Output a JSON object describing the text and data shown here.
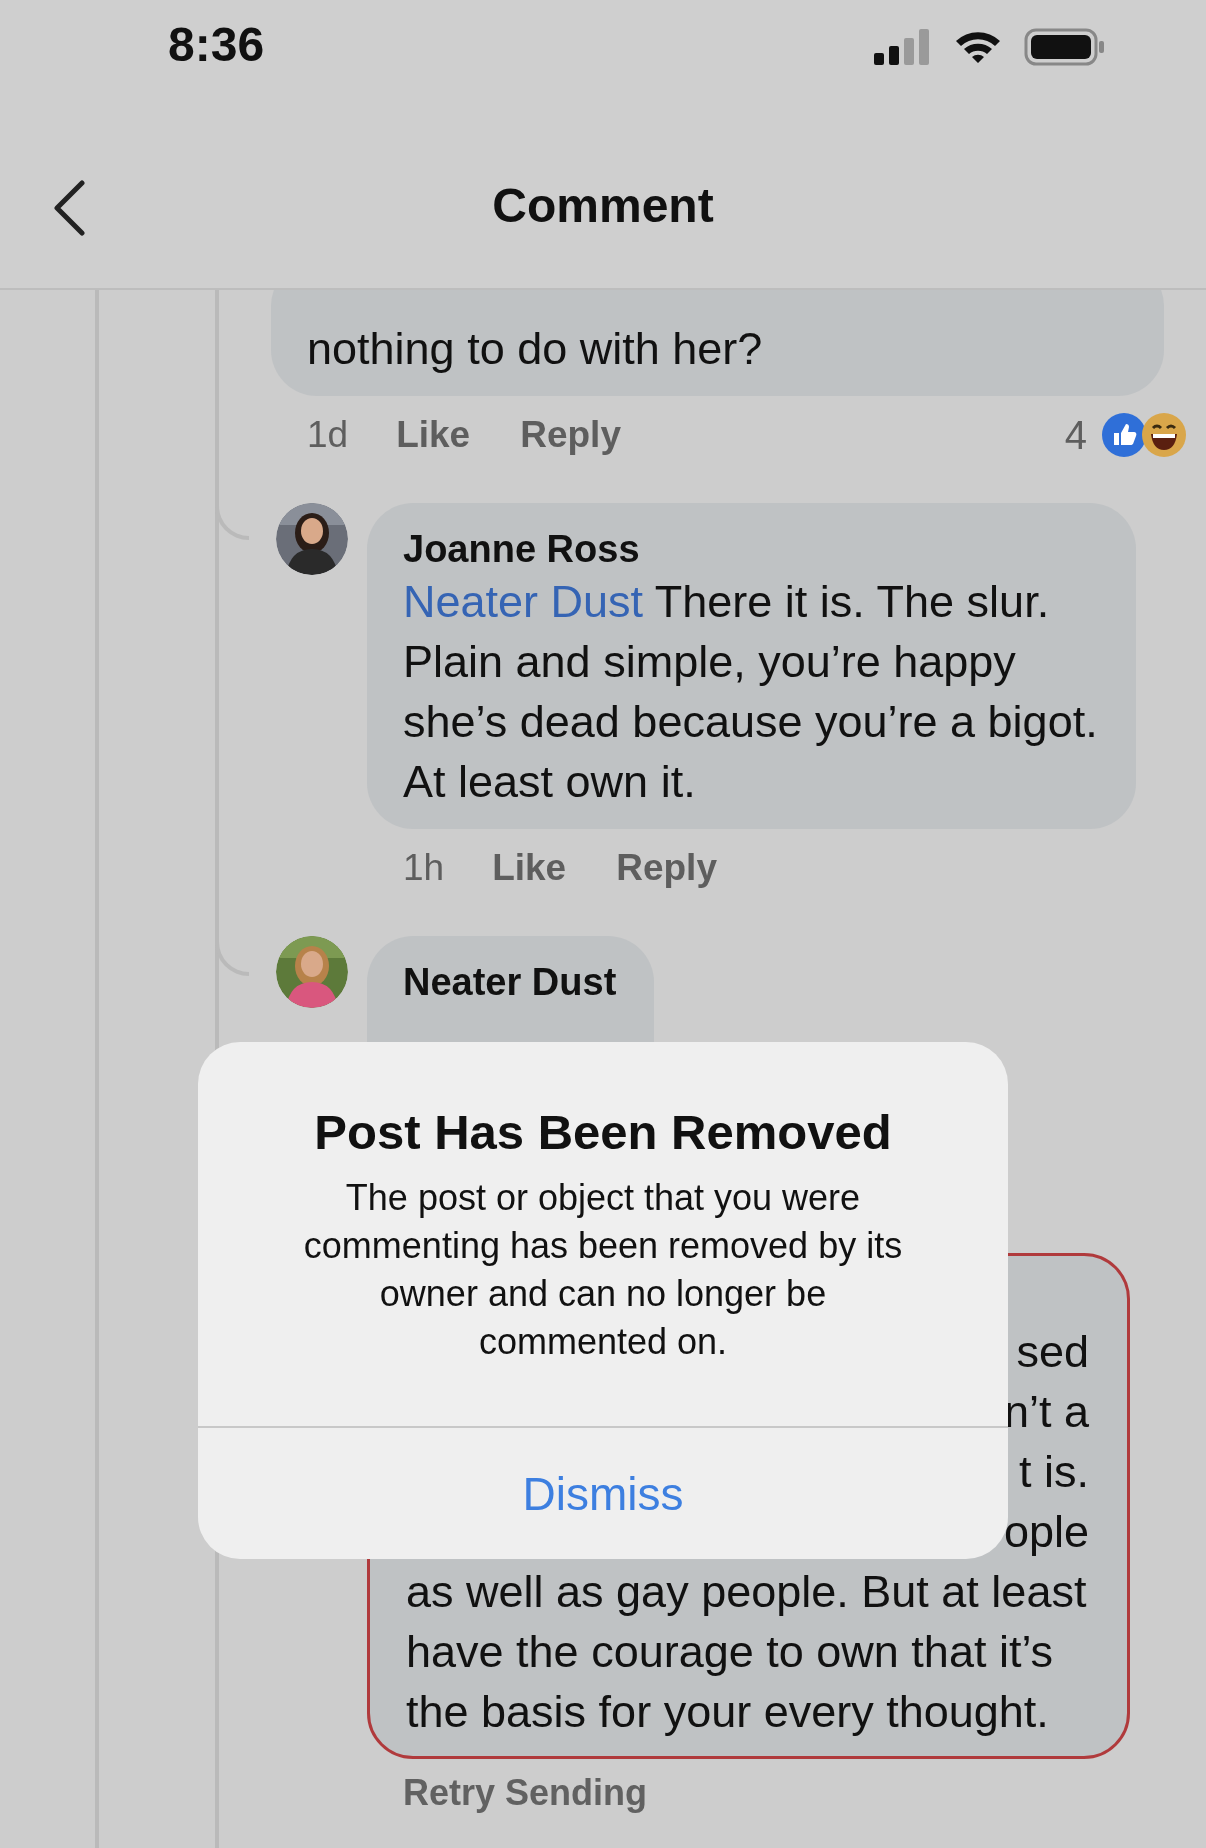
{
  "status_bar": {
    "time": "8:36"
  },
  "header": {
    "title": "Comment"
  },
  "comments": [
    {
      "kind": "partial",
      "lines": [
        "nothing to do with her?"
      ],
      "time": "1d",
      "actions": [
        "Like",
        "Reply"
      ],
      "reaction_count": "4"
    },
    {
      "kind": "reply",
      "author": "Joanne Ross",
      "mention": "Neater Dust",
      "lines": [
        "There it is. The slur.",
        "Plain and simple, you’re happy",
        "she’s dead because you’re a bigot.",
        "At least own it."
      ],
      "time": "1h",
      "actions": [
        "Like",
        "Reply"
      ]
    },
    {
      "kind": "reply",
      "author": "Neater Dust"
    },
    {
      "kind": "failed",
      "covered_lines": [
        "sed",
        "n’t a",
        "t is.",
        "ople"
      ],
      "lines": [
        "as well as gay people. But at least",
        "have the courage to own that it’s",
        "the basis for your every thought."
      ],
      "status": "Retry Sending"
    }
  ],
  "dialog": {
    "title": "Post Has Been Removed",
    "message_lines": [
      "The post or object that you were",
      "commenting has been removed by its",
      "owner and can no longer be",
      "commented on."
    ],
    "button": "Dismiss"
  }
}
